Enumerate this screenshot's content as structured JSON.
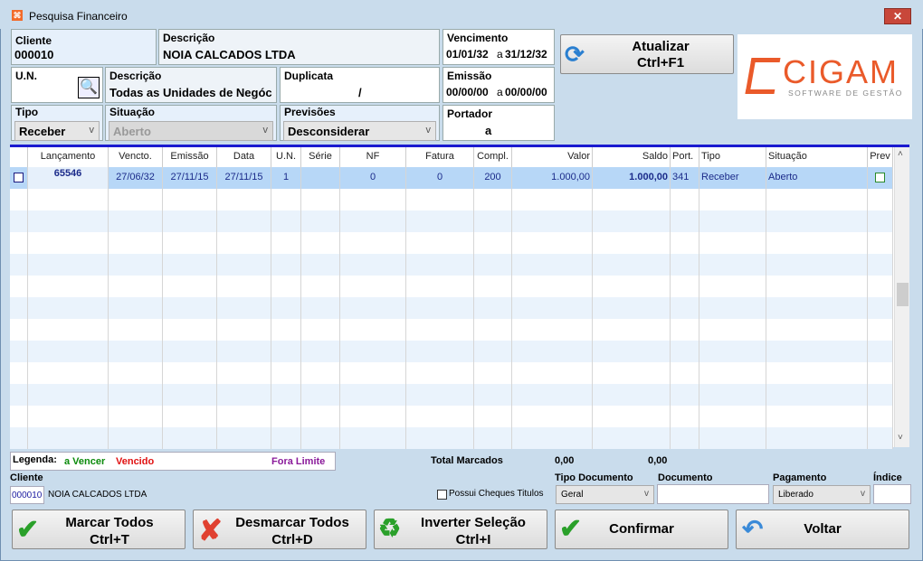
{
  "window": {
    "title": "Pesquisa Financeiro",
    "close": "✕"
  },
  "filters": {
    "cliente": {
      "label": "Cliente",
      "value": "000010"
    },
    "descricao": {
      "label": "Descrição",
      "value": "NOIA CALCADOS LTDA"
    },
    "vencimento": {
      "label": "Vencimento",
      "from": "01/01/32",
      "sep": "a",
      "to": "31/12/32"
    },
    "un": {
      "label": "U.N."
    },
    "un_descricao": {
      "label": "Descrição",
      "value": "Todas as Unidades de Negóc"
    },
    "duplicata": {
      "label": "Duplicata",
      "value": "/"
    },
    "emissao": {
      "label": "Emissão",
      "from": "00/00/00",
      "sep": "a",
      "to": "00/00/00"
    },
    "tipo": {
      "label": "Tipo",
      "value": "Receber"
    },
    "situacao": {
      "label": "Situação",
      "value": "Aberto"
    },
    "previsoes": {
      "label": "Previsões",
      "value": "Desconsiderar"
    },
    "portador": {
      "label": "Portador",
      "value": "a"
    }
  },
  "refresh": {
    "label": "Atualizar",
    "shortcut": "Ctrl+F1"
  },
  "logo": {
    "name": "CIGAM",
    "tagline": "SOFTWARE DE GESTÃO"
  },
  "grid": {
    "columns": [
      "",
      "Lançamento",
      "Vencto.",
      "Emissão",
      "Data",
      "U.N.",
      "Série",
      "NF",
      "Fatura",
      "Compl.",
      "Valor",
      "Saldo",
      "Port.",
      "Tipo",
      "Situação",
      "Prev"
    ],
    "rows": [
      [
        "",
        "65546",
        "27/06/32",
        "27/11/15",
        "27/11/15",
        "1",
        "",
        "0",
        "0",
        "200",
        "1.000,00",
        "1.000,00",
        "341",
        "Receber",
        "Aberto",
        ""
      ]
    ]
  },
  "legend": {
    "label": "Legenda:",
    "a_vencer": "a Vencer",
    "vencido": "Vencido",
    "fora_limite": "Fora Limite",
    "colors": {
      "a_vencer": "#0a8a0a",
      "vencido": "#e01010",
      "fora_limite": "#8a1a9a"
    }
  },
  "totals": {
    "label": "Total Marcados",
    "value1": "0,00",
    "value2": "0,00"
  },
  "footer": {
    "cliente_label": "Cliente",
    "cliente_code": "000010",
    "cliente_name": "NOIA CALCADOS LTDA",
    "cheques_label": "Possui Cheques Titulos",
    "tipo_doc_label": "Tipo Documento",
    "tipo_doc_value": "Geral",
    "documento_label": "Documento",
    "documento_value": "",
    "pagamento_label": "Pagamento",
    "pagamento_value": "Liberado",
    "indice_label": "Índice",
    "indice_value": ""
  },
  "buttons": {
    "marcar": {
      "label": "Marcar Todos",
      "shortcut": "Ctrl+T"
    },
    "desmarcar": {
      "label": "Desmarcar Todos",
      "shortcut": "Ctrl+D"
    },
    "inverter": {
      "label": "Inverter Seleção",
      "shortcut": "Ctrl+I"
    },
    "confirmar": {
      "label": "Confirmar"
    },
    "voltar": {
      "label": "Voltar"
    }
  }
}
